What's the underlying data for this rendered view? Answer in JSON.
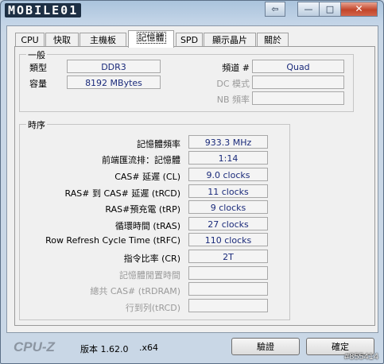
{
  "titlebar": {
    "logo": "MOBILE01",
    "restore_glyph": "⇦",
    "minimize_glyph": "—",
    "maximize_glyph": "□",
    "close_glyph": "✕"
  },
  "tabs": [
    {
      "label": "CPU"
    },
    {
      "label": "快取"
    },
    {
      "label": "主機板"
    },
    {
      "label": "記憶體"
    },
    {
      "label": "SPD"
    },
    {
      "label": "顯示晶片"
    },
    {
      "label": "關於"
    }
  ],
  "general": {
    "title": "一般",
    "type_label": "類型",
    "type_value": "DDR3",
    "size_label": "容量",
    "size_value": "8192 MBytes",
    "channel_label": "頻道 #",
    "channel_value": "Quad",
    "dc_label": "DC 模式",
    "dc_value": "",
    "nb_label": "NB 頻率",
    "nb_value": ""
  },
  "timings": {
    "title": "時序",
    "rows": [
      {
        "label": "記憶體頻率",
        "value": "933.3 MHz"
      },
      {
        "label": "前端匯流排：記憶體",
        "value": "1:14"
      },
      {
        "label": "CAS# 延遲 (CL)",
        "value": "9.0 clocks"
      },
      {
        "label": "RAS# 到 CAS# 延遲 (tRCD)",
        "value": "11 clocks"
      },
      {
        "label": "RAS#預充電 (tRP)",
        "value": "9 clocks"
      },
      {
        "label": "循環時間 (tRAS)",
        "value": "27 clocks"
      },
      {
        "label": "Row Refresh Cycle Time (tRFC)",
        "value": "110 clocks"
      },
      {
        "label": "指令比率 (CR)",
        "value": "2T"
      },
      {
        "label": "記憶體閒置時間",
        "value": ""
      },
      {
        "label": "總共 CAS# (tRDRAM)",
        "value": ""
      },
      {
        "label": "行到列(tRCD)",
        "value": ""
      }
    ]
  },
  "footer": {
    "logo": "CPU-Z",
    "version_label": "版本 1.62.0",
    "arch": ".x64",
    "validate_label": "驗證",
    "ok_label": "確定"
  },
  "watermark": "#855414"
}
